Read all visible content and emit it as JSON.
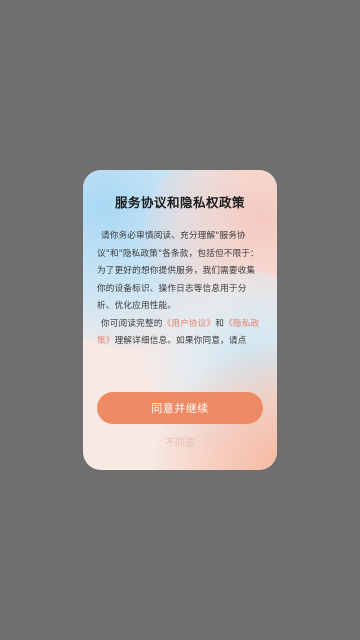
{
  "dialog": {
    "title": "服务协议和隐私权政策",
    "paragraph1": "请你务必审慎阅读、充分理解\"服务协议\"和\"隐私政策\"各条款，包括但不限于：为了更好的想你提供服务，我们需要收集你的设备标识、操作日志等信息用于分析、优化应用性能。",
    "paragraph2_prefix": "你可阅读完整的",
    "link_user_agreement": "《用户协议》",
    "paragraph2_and": "和",
    "link_privacy_policy": "《隐私政策》",
    "paragraph2_suffix": "理解详细信息。如果你同意，请点",
    "agree_button": "同意并继续",
    "disagree_button": "不同意"
  },
  "colors": {
    "overlay": "#6f6f6f",
    "accent": "#ee8a63",
    "link": "#e9806a",
    "disagree_text": "#e5c0b6"
  }
}
